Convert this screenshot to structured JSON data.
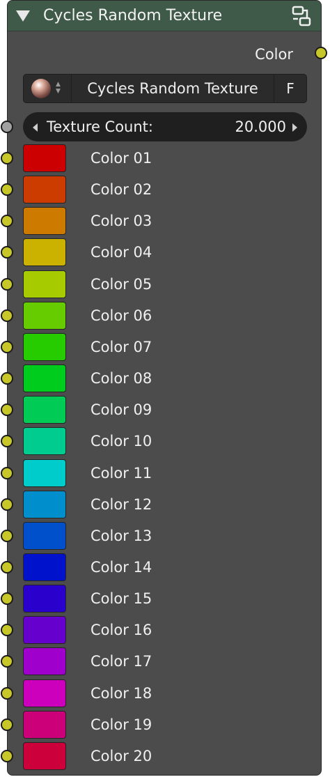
{
  "node": {
    "title": "Cycles Random Texture",
    "header_color": "#3f5a48",
    "output_label": "Color",
    "socket_color": "#c7c729",
    "value_socket_color": "#a1a1a1"
  },
  "texture_selector": {
    "name": "Cycles Random Texture",
    "fake_user_label": "F"
  },
  "texture_count": {
    "label": "Texture Count:",
    "value": "20.000"
  },
  "colors": [
    {
      "label": "Color 01",
      "hex": "#cc0000"
    },
    {
      "label": "Color 02",
      "hex": "#cc3c00"
    },
    {
      "label": "Color 03",
      "hex": "#cc7a00"
    },
    {
      "label": "Color 04",
      "hex": "#cbb200"
    },
    {
      "label": "Color 05",
      "hex": "#a6cc00"
    },
    {
      "label": "Color 06",
      "hex": "#66cc00"
    },
    {
      "label": "Color 07",
      "hex": "#27cc00"
    },
    {
      "label": "Color 08",
      "hex": "#00cc1e"
    },
    {
      "label": "Color 09",
      "hex": "#00cc55"
    },
    {
      "label": "Color 10",
      "hex": "#00cc8f"
    },
    {
      "label": "Color 11",
      "hex": "#00cccc"
    },
    {
      "label": "Color 12",
      "hex": "#008fcc"
    },
    {
      "label": "Color 13",
      "hex": "#0050cc"
    },
    {
      "label": "Color 14",
      "hex": "#0012cc"
    },
    {
      "label": "Color 15",
      "hex": "#2a00cc"
    },
    {
      "label": "Color 16",
      "hex": "#6600cc"
    },
    {
      "label": "Color 17",
      "hex": "#a000cc"
    },
    {
      "label": "Color 18",
      "hex": "#cc00bc"
    },
    {
      "label": "Color 19",
      "hex": "#cc0078"
    },
    {
      "label": "Color 20",
      "hex": "#cc003a"
    }
  ]
}
